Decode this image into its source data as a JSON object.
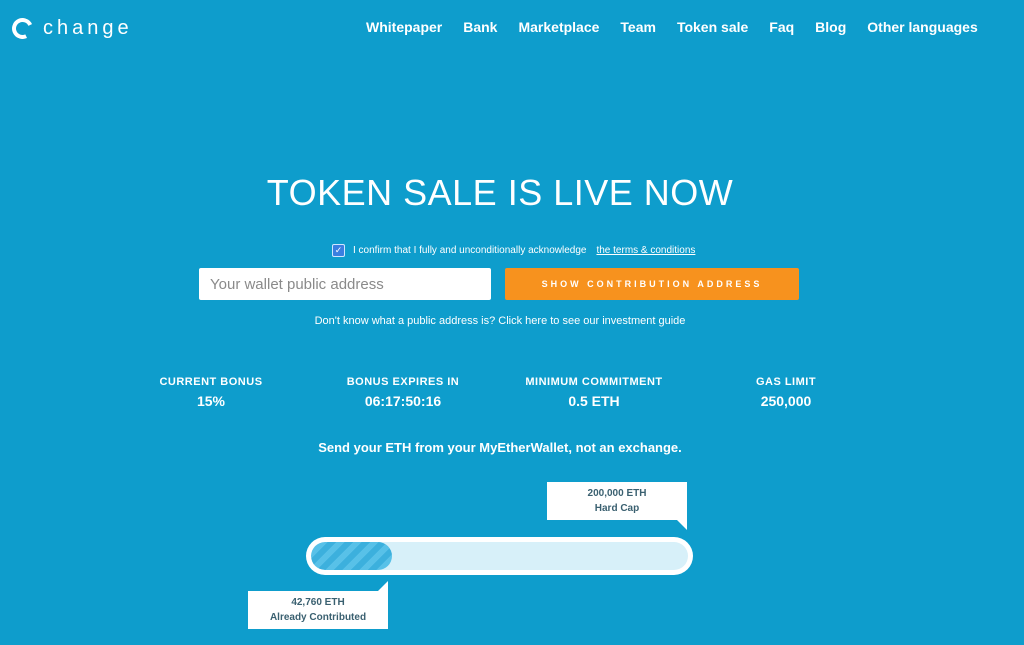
{
  "header": {
    "logo_text": "change",
    "nav": [
      "Whitepaper",
      "Bank",
      "Marketplace",
      "Team",
      "Token sale",
      "Faq",
      "Blog",
      "Other languages"
    ]
  },
  "hero": {
    "title": "TOKEN SALE IS LIVE NOW",
    "terms_text": "I confirm that I fully and unconditionally acknowledge",
    "terms_link": "the terms & conditions",
    "terms_checked": true,
    "wallet_placeholder": "Your wallet public address",
    "wallet_value": "",
    "button_label": "SHOW CONTRIBUTION ADDRESS",
    "guide_text": "Don't know what a public address is? Click here to see our investment guide"
  },
  "stats": [
    {
      "label": "CURRENT BONUS",
      "value": "15%"
    },
    {
      "label": "BONUS EXPIRES IN",
      "value": "06:17:50:16"
    },
    {
      "label": "MINIMUM COMMITMENT",
      "value": "0.5 ETH"
    },
    {
      "label": "GAS LIMIT",
      "value": "250,000"
    }
  ],
  "notice": "Send your ETH from your MyEtherWallet, not an exchange.",
  "progress": {
    "hard_cap_amount": "200,000 ETH",
    "hard_cap_label": "Hard Cap",
    "contributed_amount": "42,760 ETH",
    "contributed_label": "Already Contributed",
    "fraction": 0.2138
  },
  "colors": {
    "background": "#0e9dcc",
    "button": "#f7921e",
    "progress_fill": "#3cb0dd",
    "progress_track": "#d7f0f9"
  }
}
